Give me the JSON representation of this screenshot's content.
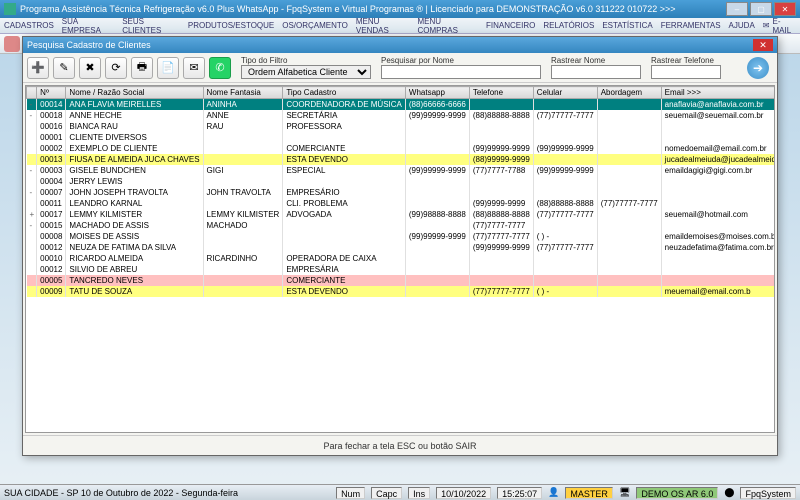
{
  "window": {
    "title": "Programa Assistência Técnica Refrigeração v6.0 Plus WhatsApp - FpqSystem e Virtual Programas ® | Licenciado para  DEMONSTRAÇÃO v6.0 311222 010722 >>>"
  },
  "menu": {
    "items": [
      "CADASTROS",
      "SUA EMPRESA",
      "SEUS CLIENTES",
      "PRODUTOS/ESTOQUE",
      "OS/ORÇAMENTO",
      "MENU VENDAS",
      "MENU COMPRAS",
      "FINANCEIRO",
      "RELATÓRIOS",
      "ESTATÍSTICA",
      "FERRAMENTAS",
      "AJUDA"
    ],
    "email": "E-MAIL"
  },
  "modal": {
    "title": "Pesquisa Cadastro de Clientes",
    "filter_type_label": "Tipo do Filtro",
    "filter_type_value": "Ordem Alfabetica Cliente",
    "search_name_label": "Pesquisar por Nome",
    "search_name_value": "",
    "track_name_label": "Rastrear Nome",
    "track_name_value": "",
    "track_phone_label": "Rastrear Telefone",
    "track_phone_value": "",
    "footer": "Para fechar a tela ESC ou botão SAIR"
  },
  "columns": [
    "Nº",
    "Nome / Razão Social",
    "Nome Fantasia",
    "Tipo Cadastro",
    "Whatsapp",
    "Telefone",
    "Celular",
    "Abordagem",
    "Email >>>"
  ],
  "rows": [
    {
      "cls": "row-sel",
      "exp": "-",
      "c": [
        "00014",
        "ANA FLAVIA MEIRELLES",
        "ANINHA",
        "COORDENADORA DE MÚSICA",
        "(88)66666-6666",
        "",
        "",
        "",
        "anaflavia@anaflavia.com.br"
      ]
    },
    {
      "cls": "row-white",
      "exp": "-",
      "c": [
        "00018",
        "ANNE HECHE",
        "ANNE",
        "SECRETÁRIA",
        "(99)99999-9999",
        "(88)88888-8888",
        "(77)77777-7777",
        "",
        "seuemail@seuemail.com.br"
      ]
    },
    {
      "cls": "row-white",
      "exp": "",
      "c": [
        "00016",
        "BIANCA RAU",
        "RAU",
        "PROFESSORA",
        "",
        "",
        "",
        "",
        ""
      ]
    },
    {
      "cls": "row-white",
      "exp": "",
      "c": [
        "00001",
        "CLIENTE DIVERSOS",
        "",
        "",
        "",
        "",
        "",
        "",
        ""
      ]
    },
    {
      "cls": "row-white",
      "exp": "",
      "c": [
        "00002",
        "EXEMPLO DE CLIENTE",
        "",
        "COMERCIANTE",
        "",
        "(99)99999-9999",
        "(99)99999-9999",
        "",
        "nomedoemail@email.com.br"
      ]
    },
    {
      "cls": "row-yellow",
      "exp": "",
      "c": [
        "00013",
        "FIUSA DE ALMEIDA JUCA CHAVES",
        "",
        "ESTA DEVENDO",
        "",
        "(88)99999-9999",
        "",
        "",
        "jucadealmeiuda@jucadealmeida.com.br"
      ]
    },
    {
      "cls": "row-white",
      "exp": "-",
      "c": [
        "00003",
        "GISELE BUNDCHEN",
        "GIGI",
        "ESPECIAL",
        "(99)99999-9999",
        "(77)7777-7788",
        "(99)99999-9999",
        "",
        "emaildagigi@gigi.com.br"
      ]
    },
    {
      "cls": "row-white",
      "exp": "",
      "c": [
        "00004",
        "JERRY LEWIS",
        "",
        "",
        "",
        "",
        "",
        "",
        ""
      ]
    },
    {
      "cls": "row-white",
      "exp": "-",
      "c": [
        "00007",
        "JOHN JOSEPH TRAVOLTA",
        "JOHN TRAVOLTA",
        "EMPRESÁRIO",
        "",
        "",
        "",
        "",
        ""
      ]
    },
    {
      "cls": "row-white",
      "exp": "",
      "c": [
        "00011",
        "LEANDRO KARNAL",
        "",
        "CLI. PROBLEMA",
        "",
        "(99)9999-9999",
        "(88)88888-8888",
        "(77)77777-7777",
        ""
      ]
    },
    {
      "cls": "row-white",
      "exp": "+",
      "c": [
        "00017",
        "LEMMY KILMISTER",
        "LEMMY KILMISTER",
        "ADVOGADA",
        "(99)98888-8888",
        "(88)88888-8888",
        "(77)77777-7777",
        "",
        "seuemail@hotmail.com"
      ]
    },
    {
      "cls": "row-white",
      "exp": "-",
      "c": [
        "00015",
        "MACHADO DE ASSIS",
        "MACHADO",
        "",
        "",
        "(77)7777-7777",
        "",
        "",
        ""
      ]
    },
    {
      "cls": "row-white",
      "exp": "",
      "c": [
        "00008",
        "MOISES DE ASSIS",
        "",
        "",
        "(99)99999-9999",
        "(77)77777-7777",
        "( )    -",
        "",
        "emaildemoises@moises.com.br"
      ]
    },
    {
      "cls": "row-white",
      "exp": "",
      "c": [
        "00012",
        "NEUZA DE FATIMA DA SILVA",
        "",
        "",
        "",
        "(99)99999-9999",
        "(77)77777-7777",
        "",
        "neuzadefatima@fatima.com.br"
      ]
    },
    {
      "cls": "row-white",
      "exp": "",
      "c": [
        "00010",
        "RICARDO ALMEIDA",
        "RICARDINHO",
        "OPERADORA DE CAIXA",
        "",
        "",
        "",
        "",
        ""
      ]
    },
    {
      "cls": "row-white",
      "exp": "",
      "c": [
        "00012",
        "SILVIO DE ABREU",
        "",
        "EMPRESÁRIA",
        "",
        "",
        "",
        "",
        ""
      ]
    },
    {
      "cls": "row-pink",
      "exp": "",
      "c": [
        "00005",
        "TANCREDO NEVES",
        "",
        "COMERCIANTE",
        "",
        "",
        "",
        "",
        ""
      ]
    },
    {
      "cls": "row-yellow",
      "exp": "",
      "c": [
        "00009",
        "TATU DE SOUZA",
        "",
        "ESTA DEVENDO",
        "",
        "(77)77777-7777",
        "( )    -",
        "",
        "meuemail@email.com.b"
      ]
    }
  ],
  "status": {
    "city": "SUA CIDADE - SP 10 de Outubro de 2022 - Segunda-feira",
    "num": "Num",
    "capc": "Capc",
    "ins": "Ins",
    "date": "10/10/2022",
    "time": "15:25:07",
    "master": "MASTER",
    "demo": "DEMO OS AR 6.0",
    "fpq": "FpqSystem"
  },
  "toolbar_colors": [
    "#d88",
    "#8d8",
    "#88d",
    "#dd8",
    "#d8d",
    "#8dd",
    "#fa0",
    "#0af",
    "#a0f",
    "#f55",
    "#5f5",
    "#55f",
    "#fa5",
    "#5fa",
    "#a5f",
    "#888",
    "#d44",
    "#4d4",
    "#44d",
    "#dd4",
    "#d4d",
    "#4dd",
    "#f80",
    "#08f",
    "#80f",
    "#f44",
    "#4f4",
    "#44f",
    "#fc4",
    "#4fc"
  ]
}
